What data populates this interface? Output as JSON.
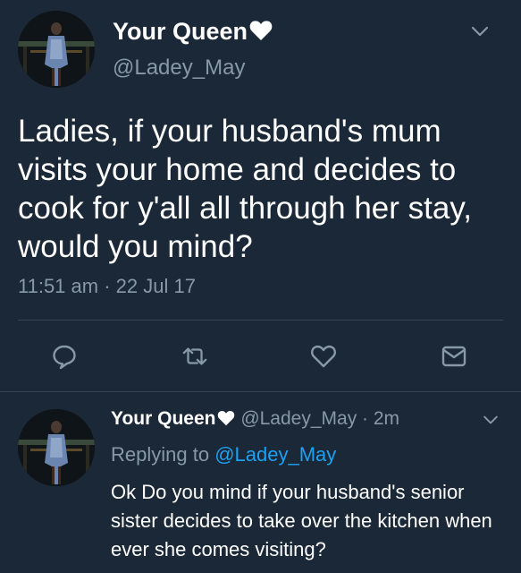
{
  "colors": {
    "background": "#1b2837",
    "secondary_text": "#8899a6",
    "link": "#1da1f2",
    "divider": "#38444d"
  },
  "main_tweet": {
    "display_name": "Your Queen",
    "handle": "@Ladey_May",
    "text": "Ladies, if your husband's mum visits your home and decides to cook for y'all all through her stay, would you mind?",
    "timestamp": "11:51 am · 22 Jul 17",
    "actions": [
      {
        "icon": "reply-icon"
      },
      {
        "icon": "retweet-icon"
      },
      {
        "icon": "like-icon"
      },
      {
        "icon": "direct-message-icon"
      }
    ]
  },
  "reply_tweet": {
    "display_name": "Your Queen",
    "handle_meta": "@Ladey_May · 2m",
    "replying_prefix": "Replying to",
    "replying_to": "@Ladey_May",
    "text": "Ok Do you mind if your husband's senior sister decides to take over the kitchen when ever she comes visiting?"
  }
}
